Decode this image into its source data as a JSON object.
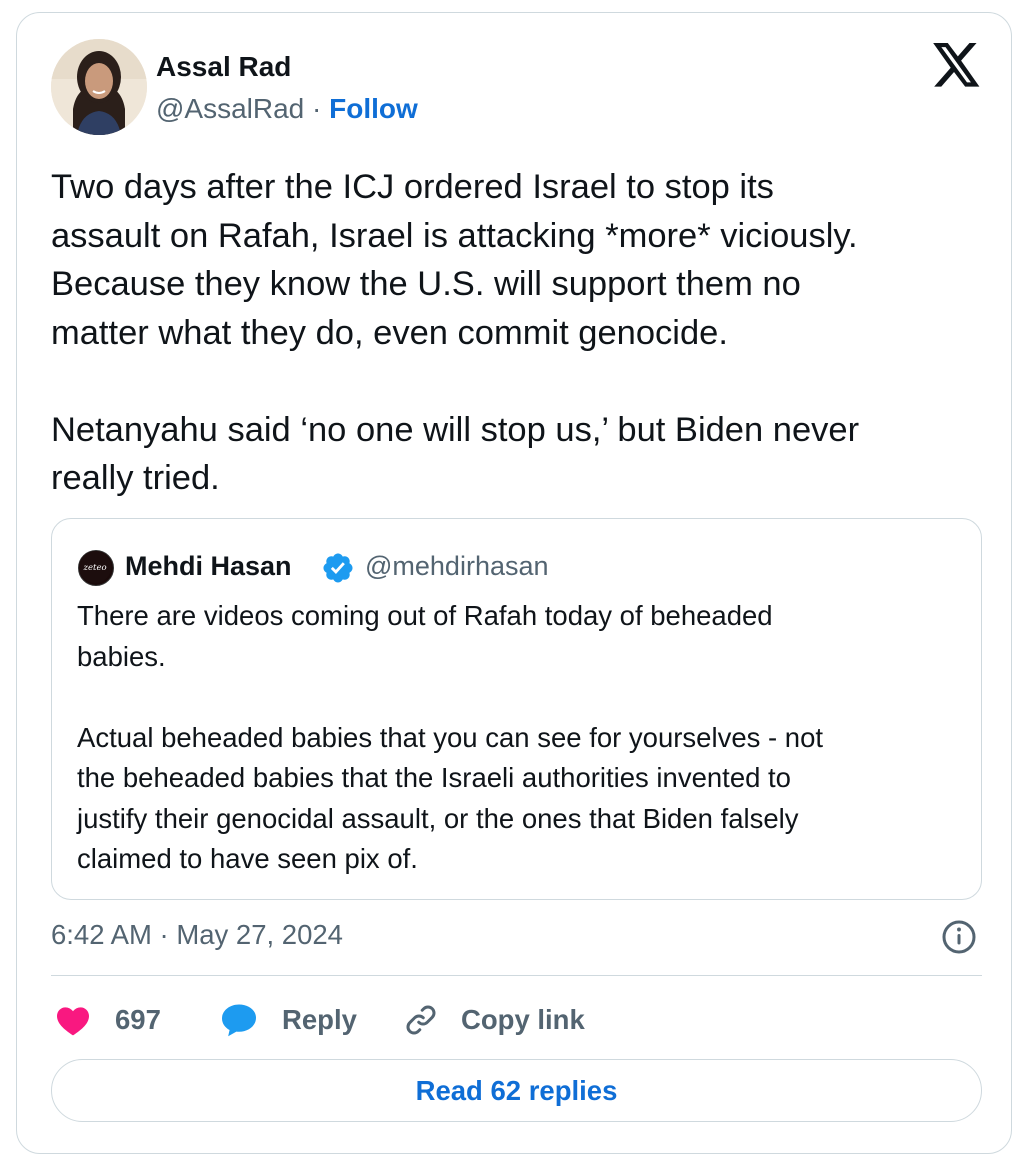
{
  "tweet": {
    "author": {
      "name": "Assal Rad",
      "handle": "@AssalRad",
      "separator": " · ",
      "follow_label": "Follow"
    },
    "text": "Two days after the ICJ ordered Israel to stop its\nassault on Rafah, Israel is attacking *more* viciously.\nBecause they know the U.S. will support them no\nmatter what they do, even commit genocide.\n\nNetanyahu said ‘no one will stop us,’ but Biden never\nreally tried.",
    "quoted": {
      "name": "Mehdi Hasan",
      "handle": "@mehdirhasan",
      "avatar_logo_text": "zeteo",
      "text": "There are videos coming out of Rafah today of beheaded\nbabies.\n\nActual beheaded babies that you can see for yourselves - not\nthe beheaded babies that the Israeli authorities invented to\njustify their genocidal assault, or the ones that Biden falsely\nclaimed to have seen pix of."
    },
    "timestamp": "6:42 AM · May 27, 2024",
    "actions": {
      "like_count": "697",
      "reply_label": "Reply",
      "copy_label": "Copy link"
    },
    "read_replies_label": "Read 62 replies"
  },
  "colors": {
    "like": "#f91880",
    "reply": "#1d9bf0",
    "link": "#0f6ed6",
    "verified": "#1d9bf0",
    "secondary_text": "#536471",
    "border": "#cfd9de"
  },
  "icons": {
    "brand": "x-logo-icon",
    "info": "info-icon",
    "like": "heart-icon",
    "reply": "speech-bubble-icon",
    "copy": "link-icon",
    "verified": "verified-badge-icon"
  }
}
